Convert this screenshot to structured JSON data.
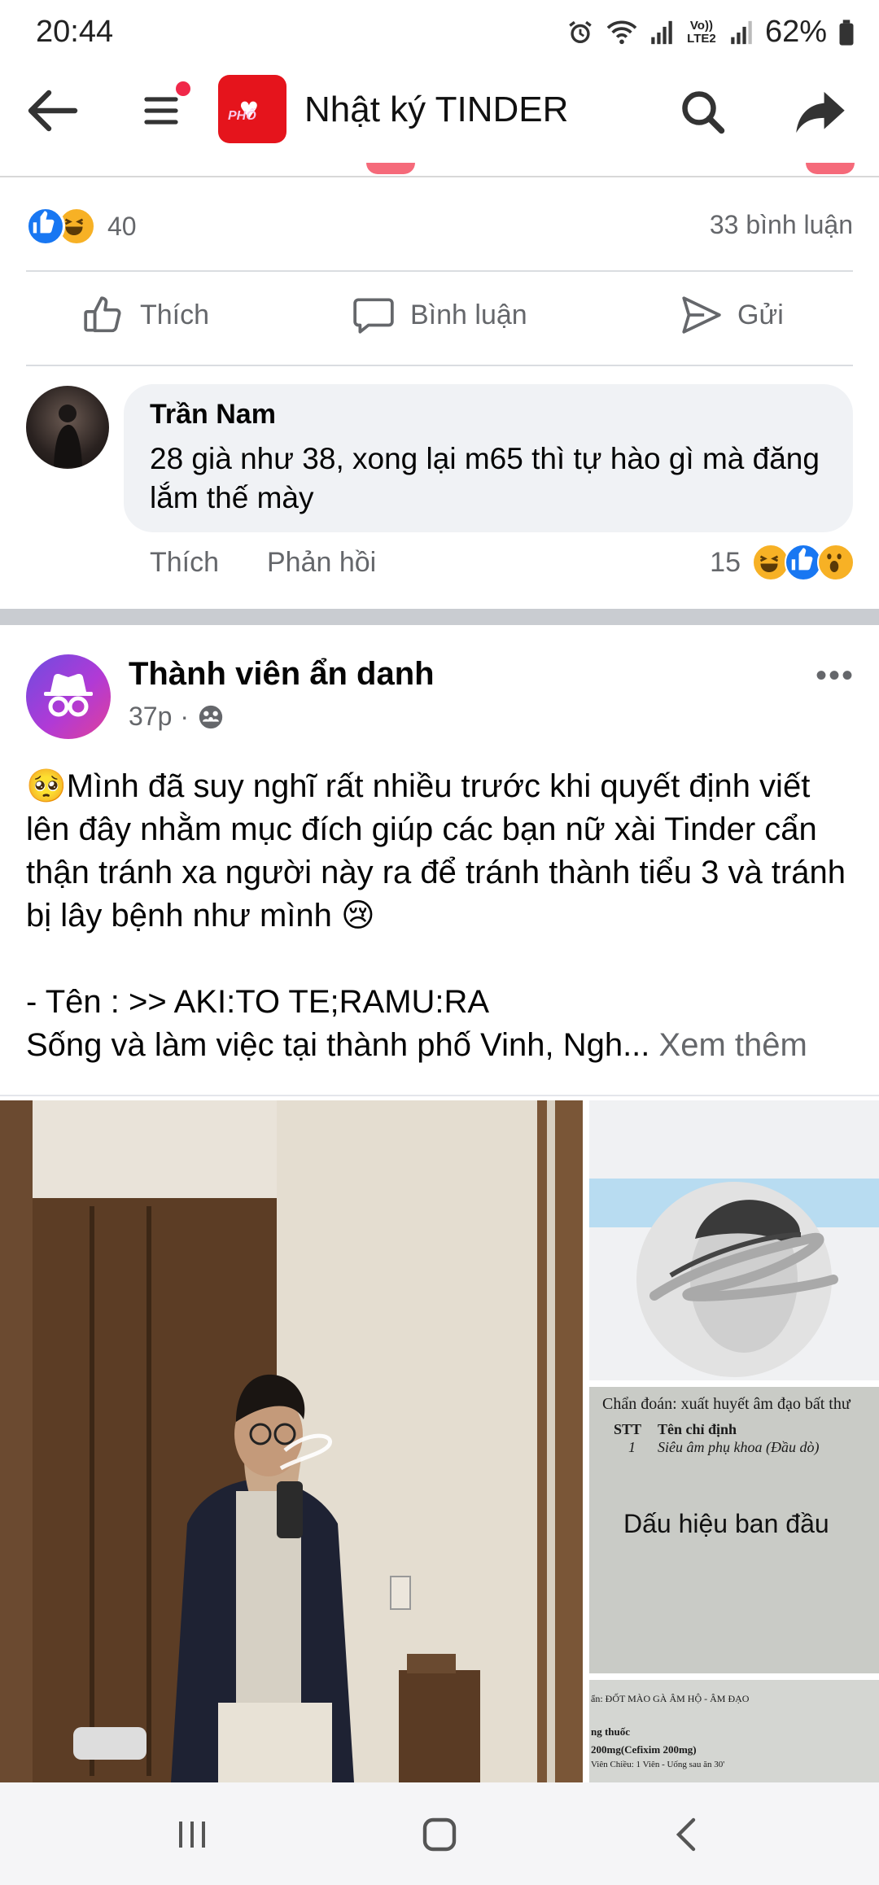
{
  "status_bar": {
    "time": "20:44",
    "network_label": "Vo)) LTE2",
    "battery": "62%"
  },
  "header": {
    "title": "Nhật ký TINDER",
    "logo_text": "PHỐ",
    "icons": [
      "back-arrow-icon",
      "menu-icon",
      "search-icon",
      "share-icon"
    ]
  },
  "previous_post": {
    "reaction_count": "40",
    "comment_count": "33 bình luận",
    "actions": {
      "like": "Thích",
      "comment": "Bình luận",
      "send": "Gửi"
    },
    "top_comment": {
      "author": "Trần Nam",
      "text": "28 già như 38, xong lại m65 thì tự hào gì mà đăng lắm thế mày",
      "like_label": "Thích",
      "reply_label": "Phản hồi",
      "reaction_count": "15"
    }
  },
  "post": {
    "author": "Thành viên ẩn danh",
    "time": "37p",
    "dot": "·",
    "line1": "🥺Mình đã suy nghĩ rất nhiều trước khi quyết định viết lên đây nhằm mục đích giúp các bạn nữ xài Tinder cẩn thận tránh xa người này ra để tránh thành tiểu 3 và tránh bị lây bệnh như mình 😢",
    "line2": "- Tên : >> AKI:TO TE;RAMU:RA",
    "line3": "Sống và làm việc tại thành phố Vinh, Ngh...",
    "see_more": "Xem thêm",
    "doc": {
      "diagnosis": "Chẩn đoán: xuất huyết âm đạo bất thư",
      "stt": "STT",
      "order_title": "Tên chỉ định",
      "row_no": "1",
      "row_text": "Siêu âm phụ khoa (Đầu dò)",
      "caption": "Dấu hiệu ban đầu",
      "bottom_line1": "ẩn: ĐỐT MÀO GÀ ÂM HỘ - ÂM ĐẠO",
      "bottom_line2": "ng thuốc",
      "bottom_line3": "200mg(Cefixim 200mg)",
      "bottom_line4": "Viên   Chiều: 1 Viên - Uống sau ăn 30'"
    }
  },
  "colors": {
    "accent_blue": "#1877f2",
    "secondary_text": "#65676b",
    "logo_red": "#e5141c"
  }
}
